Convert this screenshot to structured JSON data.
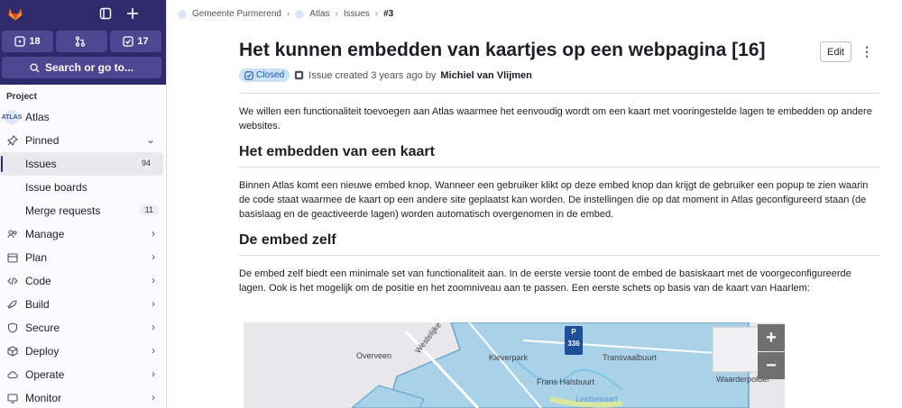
{
  "sidebar": {
    "counters": {
      "issues": "18",
      "merge_requests": "",
      "todos": "17"
    },
    "search_label": "Search or go to...",
    "section_label": "Project",
    "project_name": "Atlas",
    "project_avatar": "ATLAS",
    "pinned_label": "Pinned",
    "pinned_items": [
      {
        "label": "Issues",
        "count": "94"
      },
      {
        "label": "Issue boards",
        "count": ""
      },
      {
        "label": "Merge requests",
        "count": "11"
      }
    ],
    "menu_items": [
      {
        "label": "Manage",
        "icon": "users-icon"
      },
      {
        "label": "Plan",
        "icon": "calendar-icon"
      },
      {
        "label": "Code",
        "icon": "code-icon"
      },
      {
        "label": "Build",
        "icon": "rocket-icon"
      },
      {
        "label": "Secure",
        "icon": "shield-icon"
      },
      {
        "label": "Deploy",
        "icon": "deploy-icon"
      },
      {
        "label": "Operate",
        "icon": "cloud-icon"
      },
      {
        "label": "Monitor",
        "icon": "monitor-icon"
      }
    ]
  },
  "breadcrumb": {
    "group": "Gemeente Purmerend",
    "project": "Atlas",
    "section": "Issues",
    "current": "#3"
  },
  "issue": {
    "title": "Het kunnen embedden van kaartjes op een webpagina [16]",
    "status": "Closed",
    "created_text": "Issue created 3 years ago by",
    "author": "Michiel van Vlijmen",
    "edit_label": "Edit",
    "intro": "We willen een functionaliteit toevoegen aan Atlas waarmee het eenvoudig wordt om een kaart met vooringestelde lagen te embedden op andere websites.",
    "h1": "Het embedden van een kaart",
    "p1": "Binnen Atlas komt een nieuwe embed knop. Wanneer een gebruiker klikt op deze embed knop dan krijgt de gebruiker een popup te zien waarin de code staat waarmee de kaart op een andere site geplaatst kan worden. De instellingen die op dat moment in Atlas geconfigureerd staan (de basislaag en de geactiveerde lagen) worden automatisch overgenomen in de embed.",
    "h2": "De embed zelf",
    "p2": "De embed zelf biedt een minimale set van functionaliteit aan. In de eerste versie toont de embed de basiskaart met de voorgeconfigureerde lagen. Ook is het mogelijk om de positie en het zoomniveau aan te passen. Een eerste schets op basis van de kaart van Haarlem:"
  },
  "map": {
    "zoom_in": "+",
    "zoom_out": "−",
    "parking_letter": "P",
    "parking_number": "336",
    "labels": [
      "Overveen",
      "Westelijke Randweg",
      "Kleverpark",
      "Transvaalbuurt",
      "Frans Halsbuurt",
      "Leidsevaart",
      "Waarderpolder"
    ]
  },
  "colors": {
    "sidebar_top": "#2f2a6b",
    "accent": "#1f5aa6",
    "map_highlight": "#a9d1e8"
  }
}
